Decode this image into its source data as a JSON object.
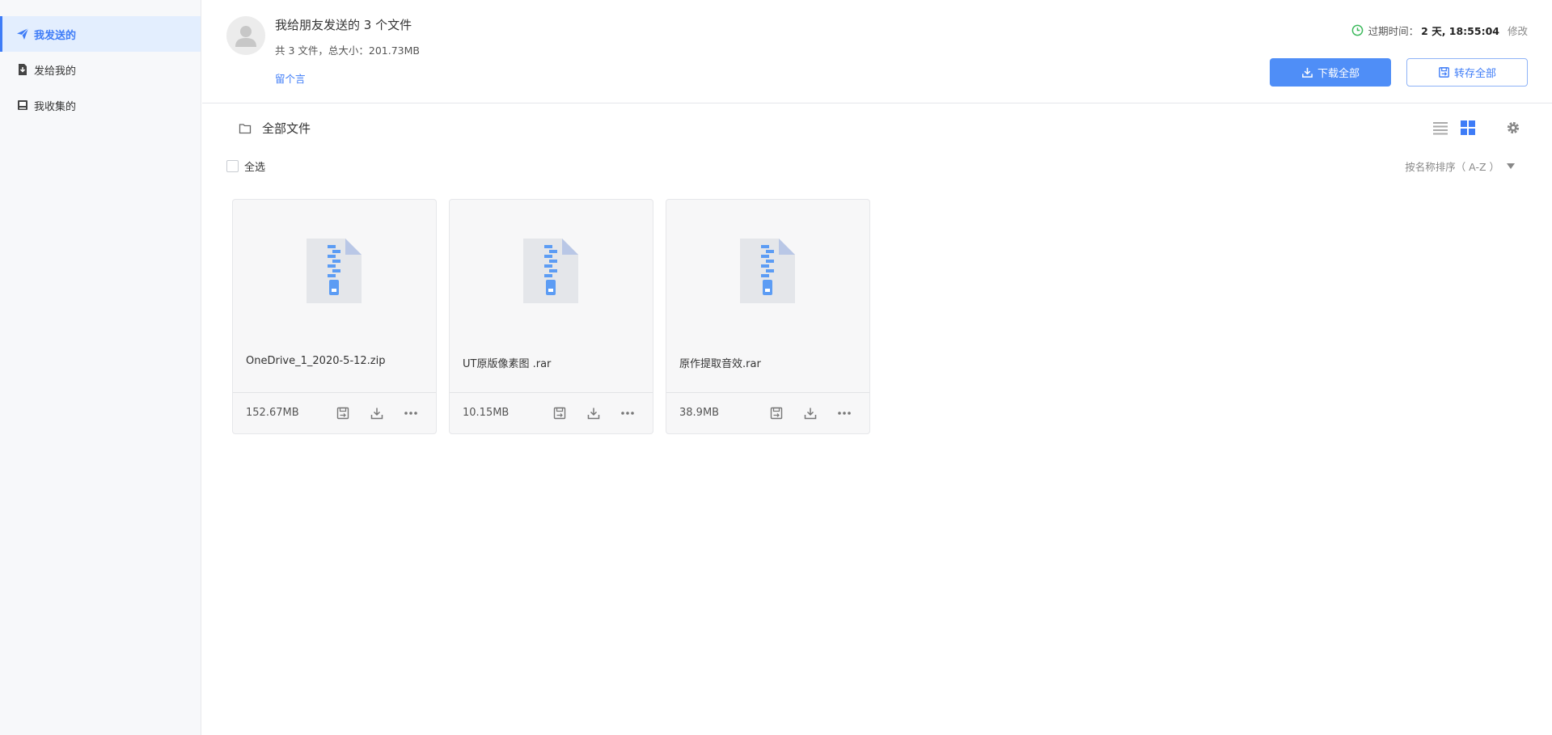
{
  "sidebar": {
    "items": [
      {
        "label": "我发送的",
        "icon": "send-icon",
        "active": true
      },
      {
        "label": "发给我的",
        "icon": "inbox-download-icon",
        "active": false
      },
      {
        "label": "我收集的",
        "icon": "tray-icon",
        "active": false
      }
    ]
  },
  "header": {
    "title": "我给朋友发送的 3 个文件",
    "summary": "共 3 文件，总大小：201.73MB",
    "message_link": "留个言",
    "expiry_label": "过期时间：",
    "expiry_value": "2 天, 18:55:04",
    "modify_label": "修改",
    "download_all": "下载全部",
    "save_all": "转存全部"
  },
  "toolbar": {
    "folder_title": "全部文件"
  },
  "select": {
    "select_all": "全选",
    "sort_label": "按名称排序（ A-Z ）"
  },
  "files": [
    {
      "name": "OneDrive_1_2020-5-12.zip",
      "size": "152.67MB"
    },
    {
      "name": "UT原版像素图 .rar",
      "size": "10.15MB"
    },
    {
      "name": "原作提取音效.rar",
      "size": "38.9MB"
    }
  ],
  "colors": {
    "accent": "#3e7cf7",
    "primary_button": "#4f8ef7",
    "clock_green": "#3cb95c"
  }
}
